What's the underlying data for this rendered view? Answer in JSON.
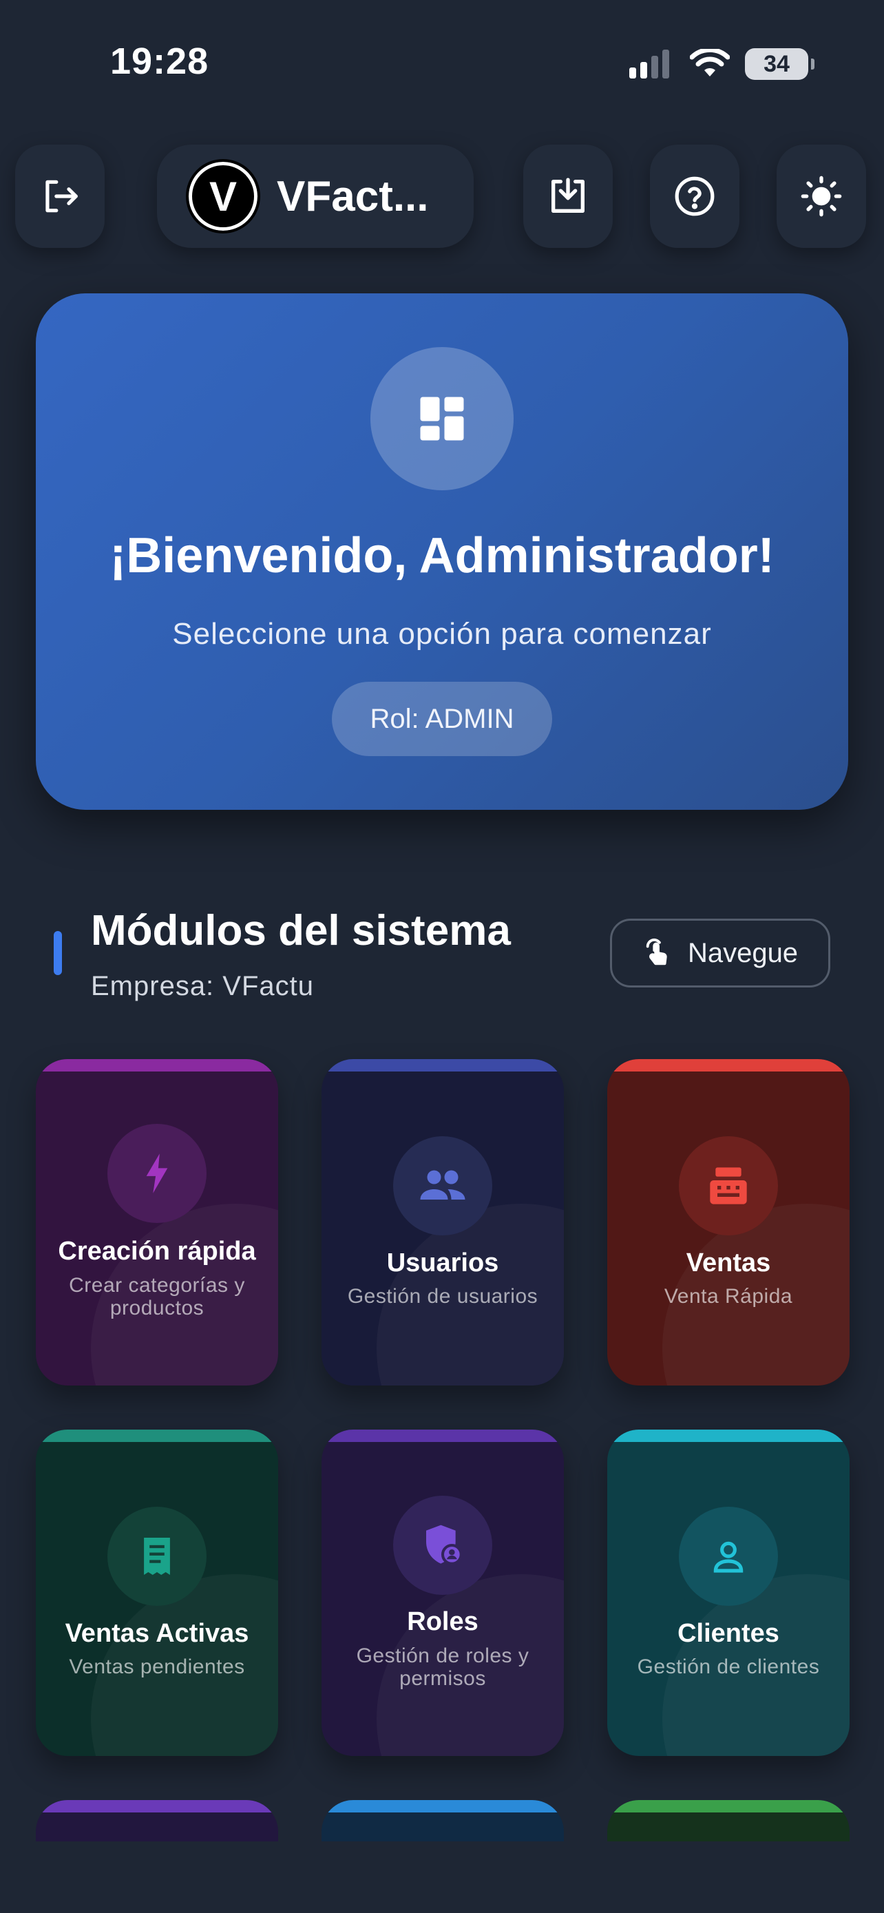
{
  "status_bar": {
    "time": "19:28",
    "battery": "34"
  },
  "header": {
    "brand_letter": "V",
    "brand_name": "VFact..."
  },
  "welcome": {
    "title": "¡Bienvenido, Administrador!",
    "subtitle": "Seleccione una opción para comenzar",
    "role": "Rol: ADMIN"
  },
  "modules_section": {
    "title": "Módulos del sistema",
    "company": "Empresa: VFactu",
    "navigate_label": "Navegue"
  },
  "modules": [
    {
      "title": "Creación rápida",
      "desc": "Crear categorías y productos",
      "icon": "lightning-icon",
      "accent": "#8a2aa0"
    },
    {
      "title": "Usuarios",
      "desc": "Gestión de usuarios",
      "icon": "users-icon",
      "accent": "#3c4aa6"
    },
    {
      "title": "Ventas",
      "desc": "Venta Rápida",
      "icon": "cash-register-icon",
      "accent": "#e0403a"
    },
    {
      "title": "Ventas Activas",
      "desc": "Ventas pendientes",
      "icon": "receipt-icon",
      "accent": "#1f8f7c"
    },
    {
      "title": "Roles",
      "desc": "Gestión de roles y permisos",
      "icon": "shield-user-icon",
      "accent": "#5b34a8"
    },
    {
      "title": "Clientes",
      "desc": "Gestión de clientes",
      "icon": "person-icon",
      "accent": "#1fb3c8"
    }
  ]
}
